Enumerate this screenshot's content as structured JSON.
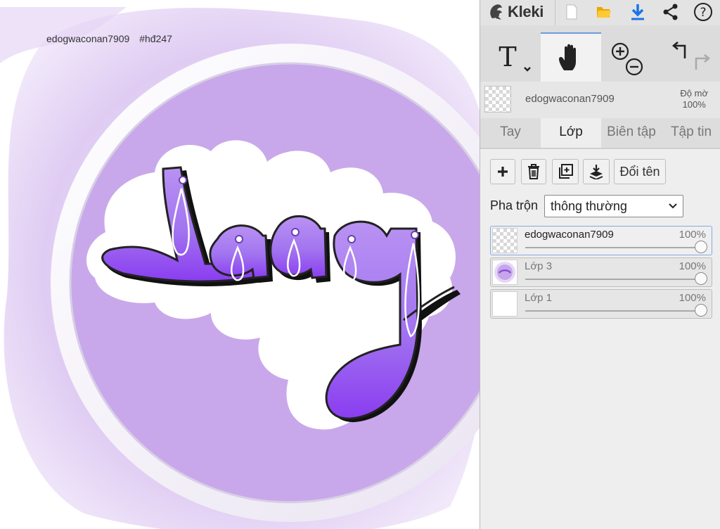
{
  "canvas": {
    "caption_user": "edogwaconan7909",
    "caption_tag": "#hđ247",
    "artwork_text": "Lag"
  },
  "app": {
    "name": "Kleki"
  },
  "layer_header": {
    "name": "edogwaconan7909",
    "opacity_label": "Độ mờ",
    "opacity_value": "100%"
  },
  "tabs": [
    {
      "label": "Tay",
      "active": false
    },
    {
      "label": "Lớp",
      "active": true
    },
    {
      "label": "Biên tập",
      "active": false
    },
    {
      "label": "Tập tin",
      "active": false
    }
  ],
  "layer_buttons": {
    "rename_label": "Đổi tên"
  },
  "blend": {
    "label": "Pha trộn",
    "value": "thông thường"
  },
  "layers": [
    {
      "name": "edogwaconan7909",
      "opacity": "100%",
      "selected": true
    },
    {
      "name": "Lớp 3",
      "opacity": "100%",
      "selected": false
    },
    {
      "name": "Lớp 1",
      "opacity": "100%",
      "selected": false
    }
  ],
  "colors": {
    "accent_blue": "#1a73e8",
    "folder_yellow": "#f0b400",
    "lilac": "#c7a2e8",
    "purple_text": "#8b4cf0"
  }
}
